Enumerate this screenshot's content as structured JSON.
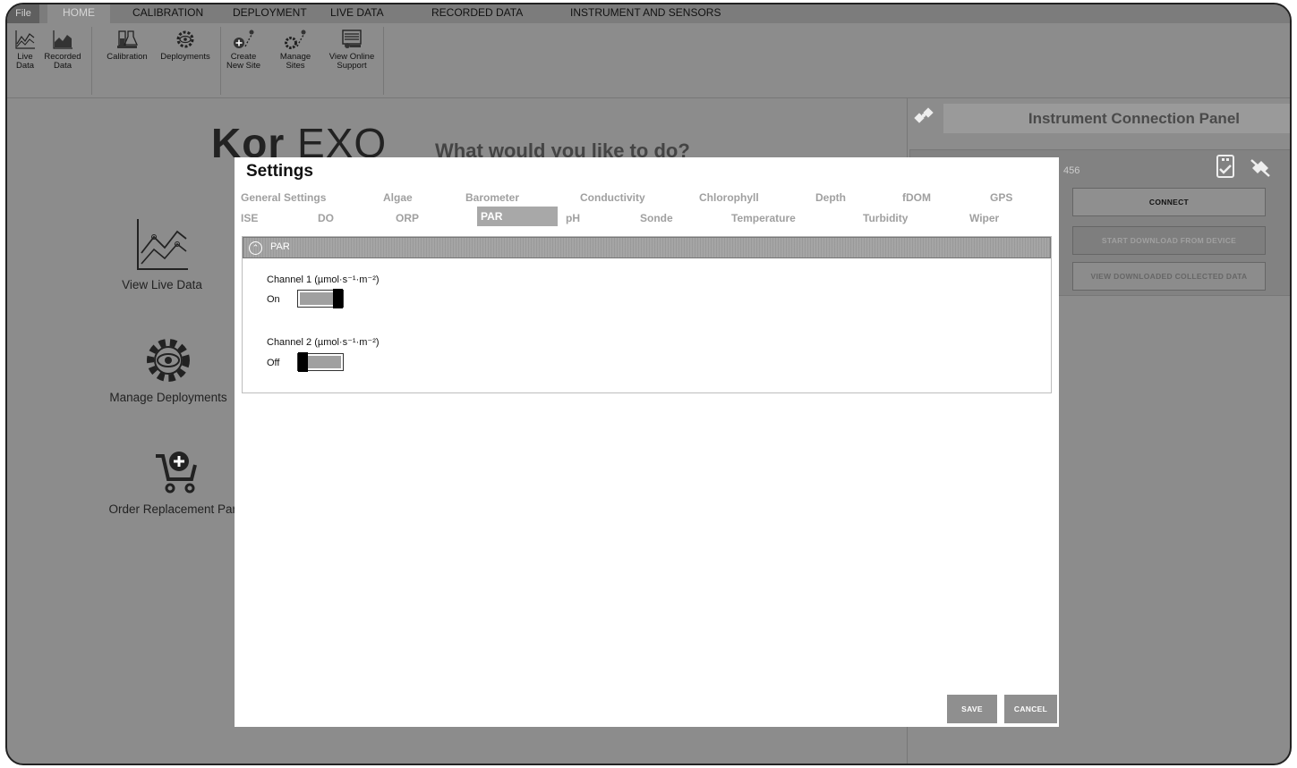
{
  "menu": {
    "file": "File",
    "home": "HOME",
    "items": [
      "CALIBRATION",
      "DEPLOYMENT",
      "LIVE DATA",
      "RECORDED DATA",
      "INSTRUMENT AND SENSORS"
    ]
  },
  "ribbon": {
    "live_data": [
      "Live",
      "Data"
    ],
    "recorded_data": [
      "Recorded",
      "Data"
    ],
    "calibration": "Calibration",
    "deployments": "Deployments",
    "create_site": [
      "Create",
      "New Site"
    ],
    "manage_sites": [
      "Manage",
      "Sites"
    ],
    "view_support": [
      "View Online",
      "Support"
    ]
  },
  "main": {
    "logo_kor": "Kor",
    "logo_exo": "EXO",
    "prompt": "What would you like to do?",
    "tiles": {
      "live": "View Live Data",
      "deployments": "Manage Deployments",
      "order": "Order Replacement Parts"
    }
  },
  "panel": {
    "title": "Instrument Connection Panel",
    "serial_fragment": "456",
    "connect": "CONNECT",
    "download": "START DOWNLOAD FROM DEVICE",
    "view_collected": "VIEW DOWNLOADED COLLECTED DATA"
  },
  "dialog": {
    "title": "Settings",
    "tabs_row1": [
      "General Settings",
      "Algae",
      "Barometer",
      "Conductivity",
      "Chlorophyll",
      "Depth",
      "fDOM",
      "GPS"
    ],
    "tabs_row2": [
      "ISE",
      "DO",
      "ORP",
      "PAR",
      "pH",
      "Sonde",
      "Temperature",
      "Turbidity",
      "Wiper"
    ],
    "active_tab": "PAR",
    "section_title": "PAR",
    "channel1": {
      "label": "Channel 1 (µmol·s⁻¹·m⁻²)",
      "state": "On",
      "on": true
    },
    "channel2": {
      "label": "Channel 2 (µmol·s⁻¹·m⁻²)",
      "state": "Off",
      "on": false
    },
    "save": "SAVE",
    "cancel": "CANCEL"
  }
}
